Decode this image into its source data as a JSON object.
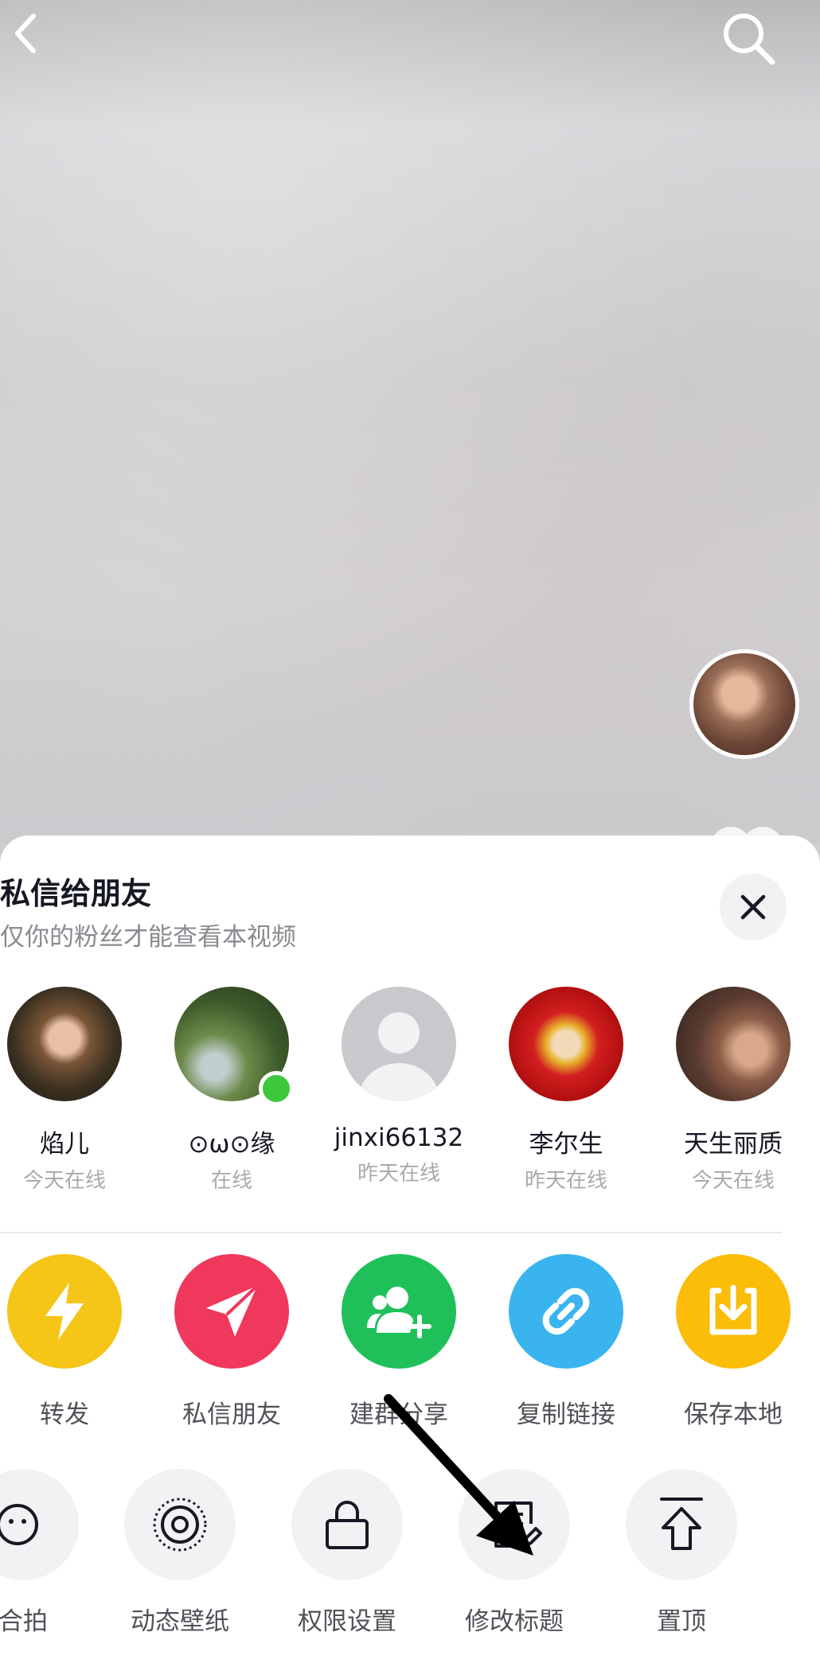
{
  "sheet": {
    "title": "私信给朋友",
    "subtitle": "仅你的粉丝才能查看本视频"
  },
  "friends": [
    {
      "name": "焰儿",
      "status": "今天在线"
    },
    {
      "name": "⊙ω⊙缘",
      "status": "在线"
    },
    {
      "name": "jinxi66132",
      "status": "昨天在线"
    },
    {
      "name": "李尔生",
      "status": "昨天在线"
    },
    {
      "name": "天生丽质",
      "status": "今天在线"
    }
  ],
  "share_actions": [
    {
      "label": "转发",
      "icon": "lightning-icon",
      "color": "#f5c518"
    },
    {
      "label": "私信朋友",
      "icon": "paper-plane-icon",
      "color": "#f0385c"
    },
    {
      "label": "建群分享",
      "icon": "add-group-icon",
      "color": "#1fc05a"
    },
    {
      "label": "复制链接",
      "icon": "link-icon",
      "color": "#3ab4ef"
    },
    {
      "label": "保存本地",
      "icon": "download-icon",
      "color": "#fbbd08"
    }
  ],
  "tools": [
    {
      "label": "合拍",
      "icon": "duet-icon"
    },
    {
      "label": "动态壁纸",
      "icon": "wallpaper-icon"
    },
    {
      "label": "权限设置",
      "icon": "lock-icon"
    },
    {
      "label": "修改标题",
      "icon": "edit-title-icon"
    },
    {
      "label": "置顶",
      "icon": "pin-top-icon"
    }
  ]
}
